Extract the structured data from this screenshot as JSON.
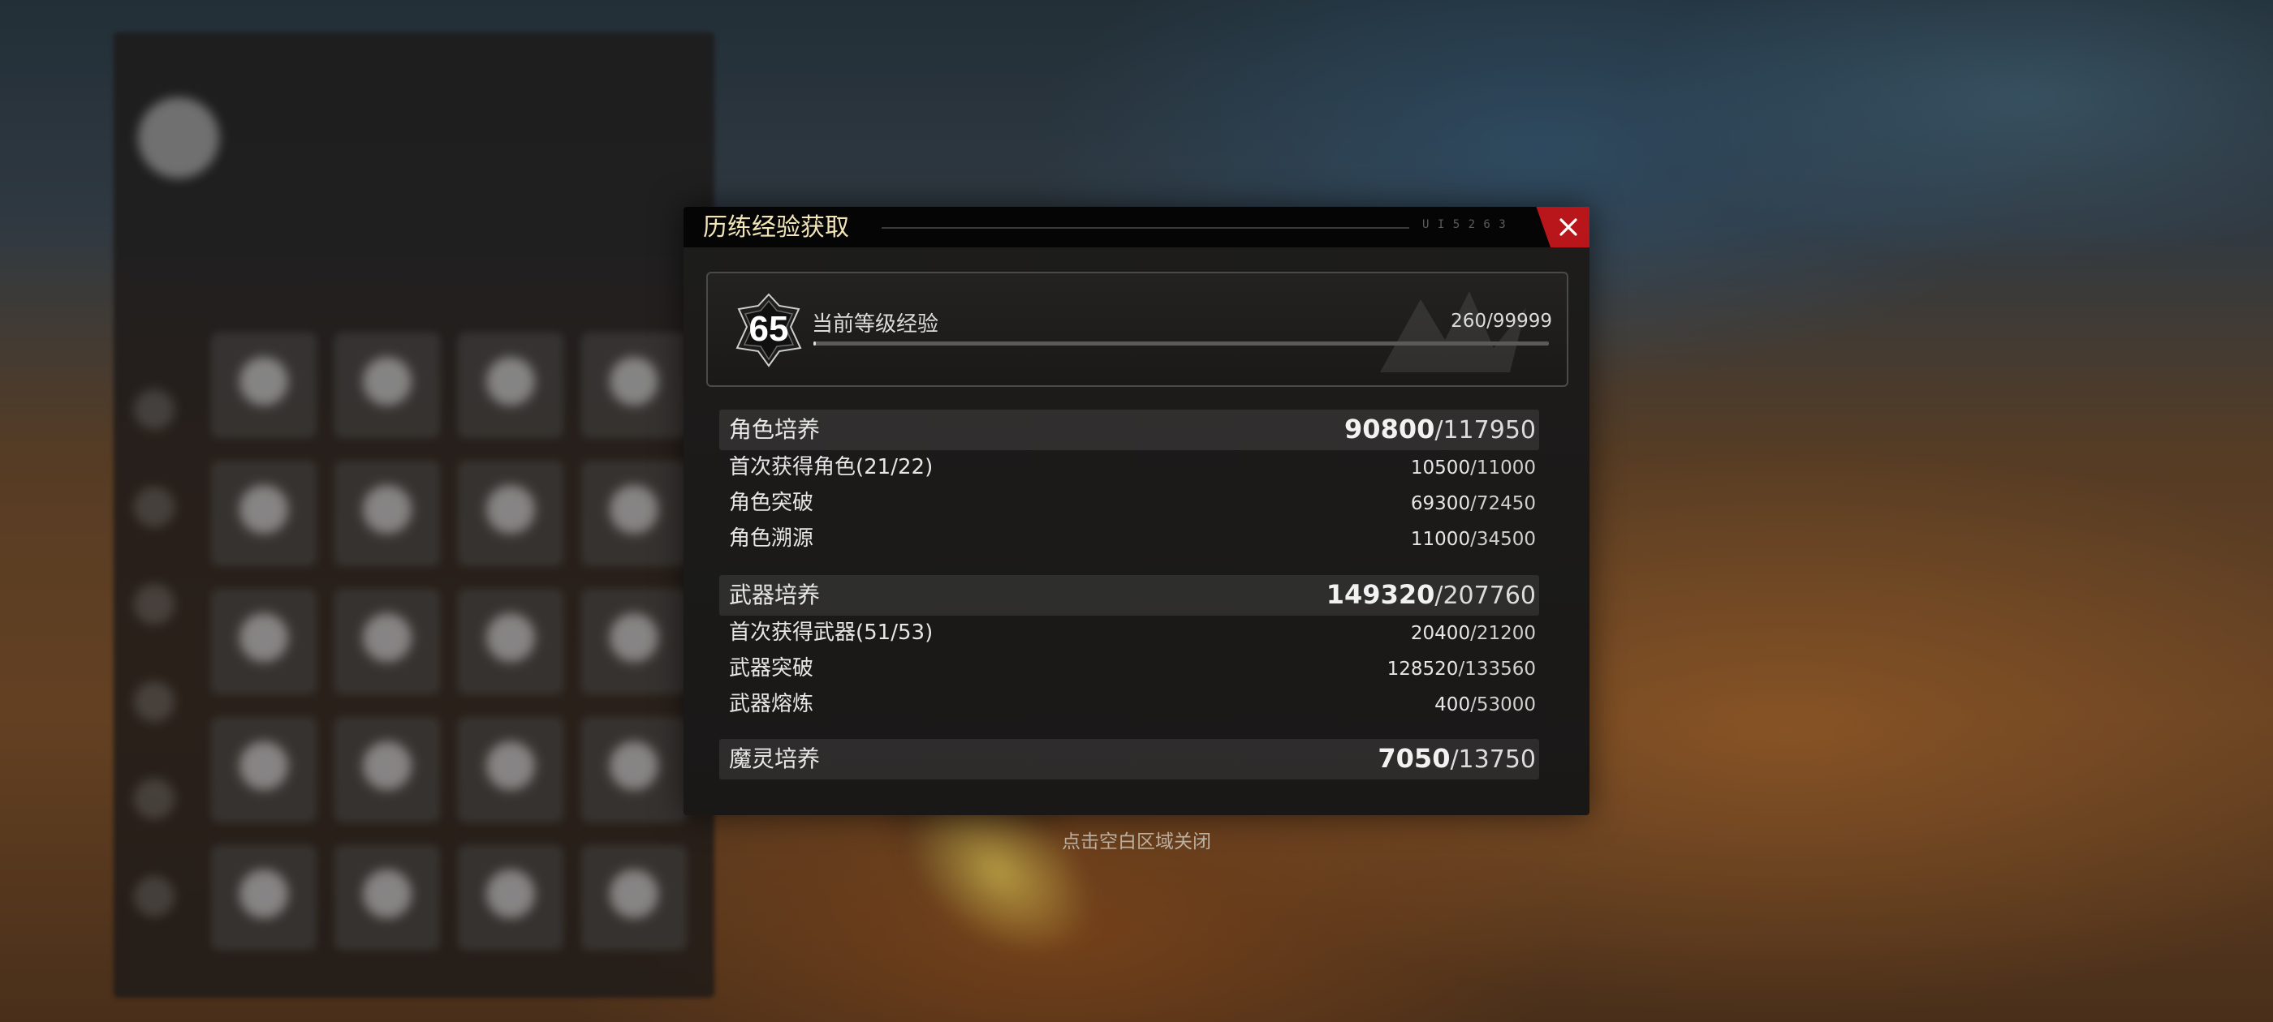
{
  "dialog": {
    "title": "历练经验获取",
    "header_code": "U I 5 2 6 3",
    "close_icon": "close-icon",
    "accent_color": "#b8161b"
  },
  "level": {
    "number": "65",
    "label": "当前等级经验",
    "current": "260",
    "max": "/99999",
    "progress_fraction": 0.0026
  },
  "sections": [
    {
      "title": "角色培养",
      "current": "90800",
      "total": "/117950",
      "rows": [
        {
          "label": "首次获得角色(21/22)",
          "current": "10500",
          "total": "/11000"
        },
        {
          "label": "角色突破",
          "current": "69300",
          "total": "/72450"
        },
        {
          "label": "角色溯源",
          "current": "11000",
          "total": "/34500"
        }
      ]
    },
    {
      "title": "武器培养",
      "current": "149320",
      "total": "/207760",
      "rows": [
        {
          "label": "首次获得武器(51/53)",
          "current": "20400",
          "total": "/21200"
        },
        {
          "label": "武器突破",
          "current": "128520",
          "total": "/133560"
        },
        {
          "label": "武器熔炼",
          "current": "400",
          "total": "/53000"
        }
      ]
    },
    {
      "title": "魔灵培养",
      "current": "7050",
      "total": "/13750",
      "rows": []
    }
  ],
  "close_hint": "点击空白区域关闭"
}
